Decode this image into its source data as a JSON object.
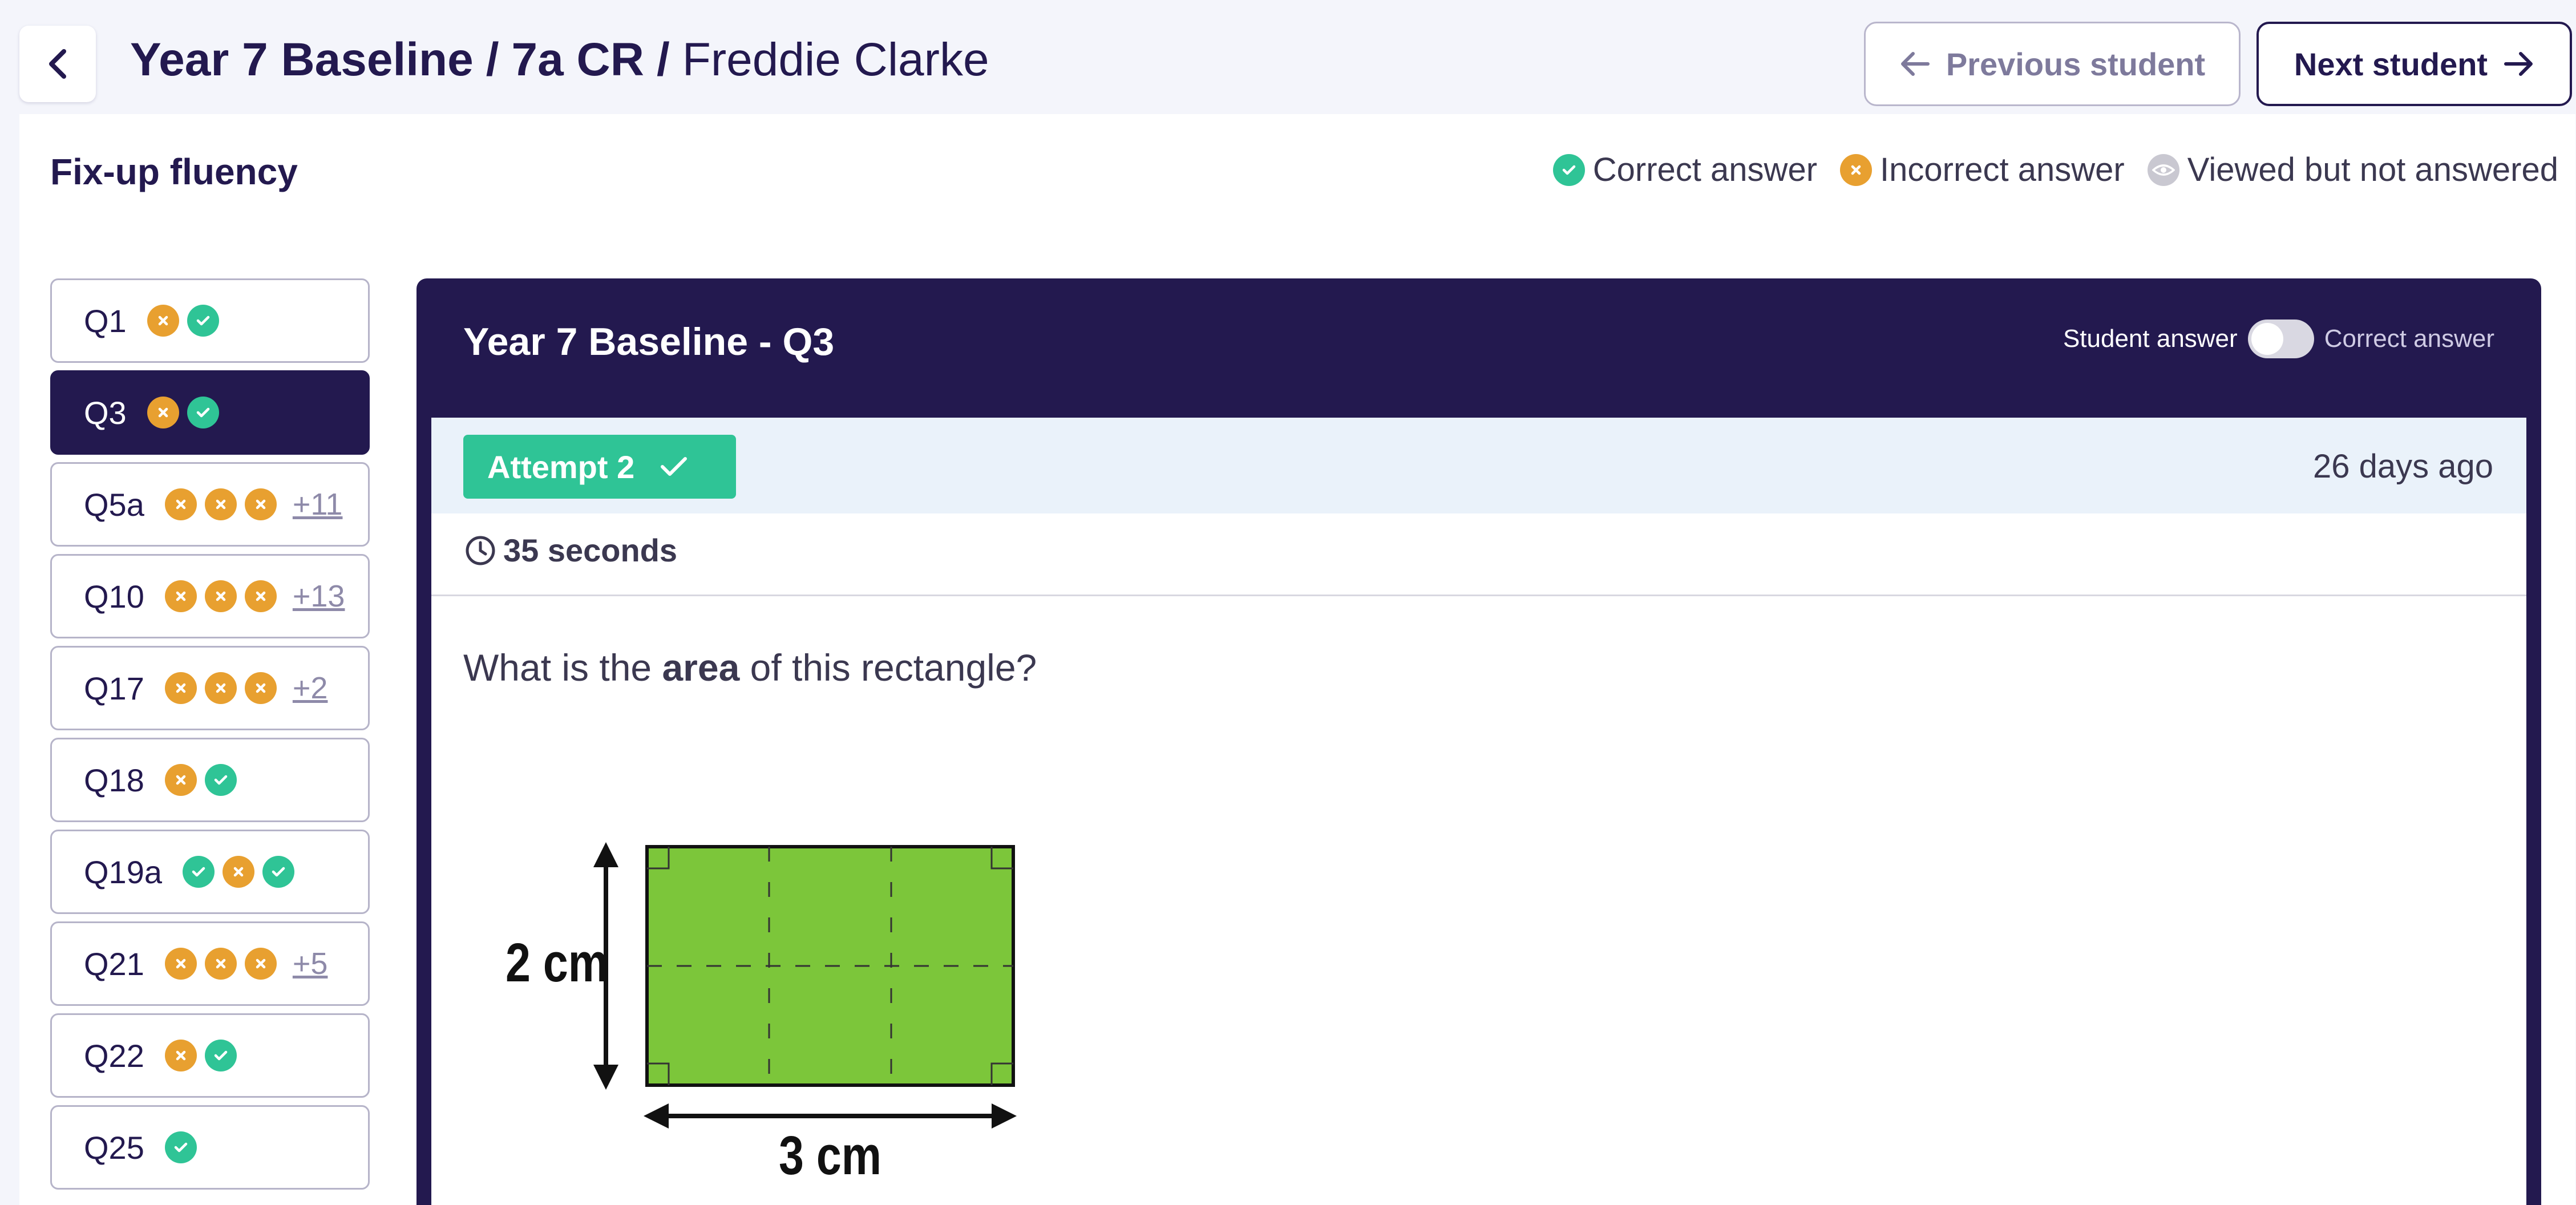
{
  "header": {
    "assessment": "Year 7 Baseline",
    "class_name": "7a CR",
    "student": "Freddie Clarke",
    "separator": "/",
    "prev_label": "Previous student",
    "next_label": "Next student"
  },
  "section": {
    "title": "Fix-up fluency"
  },
  "legend": {
    "correct": "Correct answer",
    "incorrect": "Incorrect answer",
    "viewed": "Viewed but not answered"
  },
  "questions": [
    {
      "label": "Q1",
      "statuses": [
        "incorrect",
        "correct"
      ],
      "more": "",
      "active": false
    },
    {
      "label": "Q3",
      "statuses": [
        "incorrect",
        "correct"
      ],
      "more": "",
      "active": true
    },
    {
      "label": "Q5a",
      "statuses": [
        "incorrect",
        "incorrect",
        "incorrect"
      ],
      "more": "+11",
      "active": false
    },
    {
      "label": "Q10",
      "statuses": [
        "incorrect",
        "incorrect",
        "incorrect"
      ],
      "more": "+13",
      "active": false
    },
    {
      "label": "Q17",
      "statuses": [
        "incorrect",
        "incorrect",
        "incorrect"
      ],
      "more": "+2",
      "active": false
    },
    {
      "label": "Q18",
      "statuses": [
        "incorrect",
        "correct"
      ],
      "more": "",
      "active": false
    },
    {
      "label": "Q19a",
      "statuses": [
        "correct",
        "incorrect",
        "correct"
      ],
      "more": "",
      "active": false
    },
    {
      "label": "Q21",
      "statuses": [
        "incorrect",
        "incorrect",
        "incorrect"
      ],
      "more": "+5",
      "active": false
    },
    {
      "label": "Q22",
      "statuses": [
        "incorrect",
        "correct"
      ],
      "more": "",
      "active": false
    },
    {
      "label": "Q25",
      "statuses": [
        "correct"
      ],
      "more": "",
      "active": false
    }
  ],
  "card": {
    "title": "Year 7 Baseline - Q3",
    "toggle_left": "Student answer",
    "toggle_right": "Correct answer",
    "toggle_on": false,
    "attempt_label": "Attempt 2",
    "attempt_ago": "26 days ago",
    "duration": "35 seconds",
    "question_pre": "What is the ",
    "question_bold": "area",
    "question_post": " of this rectangle?",
    "figure": {
      "height_label": "2 cm",
      "width_label": "3 cm"
    }
  },
  "colors": {
    "navy": "#23194f",
    "correct": "#2fc496",
    "incorrect": "#e8a030",
    "rect_fill": "#7cc63a"
  },
  "icons": {
    "back": "chevron-left-icon",
    "prev": "arrow-left-icon",
    "next": "arrow-right-icon",
    "correct": "check-circle-icon",
    "incorrect": "x-circle-icon",
    "viewed": "eye-icon",
    "clock": "clock-icon"
  }
}
